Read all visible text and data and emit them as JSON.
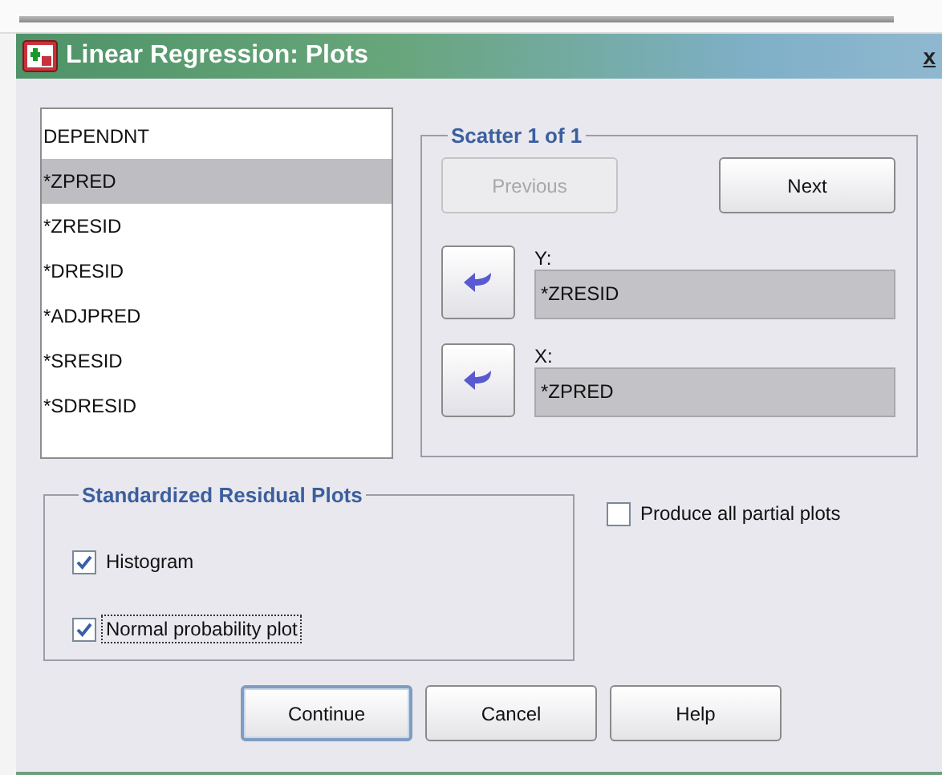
{
  "window": {
    "title": "Linear Regression: Plots",
    "close": "x"
  },
  "variables": [
    {
      "name": "DEPENDNT",
      "selected": false
    },
    {
      "name": "*ZPRED",
      "selected": true
    },
    {
      "name": "*ZRESID",
      "selected": false
    },
    {
      "name": "*DRESID",
      "selected": false
    },
    {
      "name": "*ADJPRED",
      "selected": false
    },
    {
      "name": "*SRESID",
      "selected": false
    },
    {
      "name": "*SDRESID",
      "selected": false
    }
  ],
  "scatter": {
    "title": "Scatter 1 of 1",
    "previous": {
      "label": "Previous",
      "disabled": true
    },
    "next": {
      "label": "Next",
      "disabled": false
    },
    "y": {
      "label": "Y:",
      "value": "*ZRESID"
    },
    "x": {
      "label": "X:",
      "value": "*ZPRED"
    }
  },
  "residual_plots": {
    "title": "Standardized Residual Plots",
    "options": [
      {
        "label": "Histogram",
        "checked": true,
        "focused": false
      },
      {
        "label": "Normal probability plot",
        "checked": true,
        "focused": true
      }
    ]
  },
  "partial_plots": {
    "label": "Produce all partial plots",
    "checked": false
  },
  "buttons": [
    {
      "label": "Continue",
      "default": true
    },
    {
      "label": "Cancel",
      "default": false
    },
    {
      "label": "Help",
      "default": false
    }
  ]
}
